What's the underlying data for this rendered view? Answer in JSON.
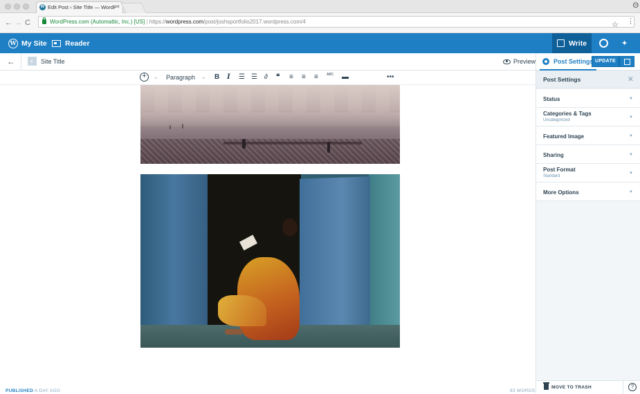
{
  "browser": {
    "tab_title": "Edit Post ‹ Site Title — WordP",
    "tab_close": "×",
    "nav_back": "←",
    "nav_forward": "→",
    "nav_reload": "C",
    "secure_label": "WordPress.com (Automattic, Inc.) [US]",
    "url_separator": "|",
    "url_scheme": "https://",
    "url_host": "wordpress.com",
    "url_path": "/post/joshsportfolio2017.wordpress.com/4",
    "star": "☆",
    "menu": "⋮",
    "profile": "Θ"
  },
  "masterbar": {
    "my_site": "My Site",
    "reader": "Reader",
    "write": "Write",
    "accent": "#1f7fc4"
  },
  "editor": {
    "back": "←",
    "site_title": "Site Title",
    "preview": "Preview",
    "post_settings_tab": "Post Settings",
    "update": "UPDATE"
  },
  "toolbar": {
    "add": "+",
    "add_caret": "⌄",
    "format": "Paragraph",
    "format_caret": "⌄",
    "bold": "B",
    "italic": "I",
    "bullet_list": "☰",
    "numbered_list": "☰",
    "link": "∂",
    "quote": "❝",
    "align_left": "≡",
    "align_center": "≡",
    "align_right": "≡",
    "spellcheck": "ABC",
    "read_more": "▬",
    "more": "•••"
  },
  "status": {
    "published_strong": "PUBLISHED",
    "published_rest": "A DAY AGO",
    "word_count": "83 WORDS"
  },
  "sidebar": {
    "title": "Post Settings",
    "close": "✕",
    "items": [
      {
        "label": "Status",
        "sub": ""
      },
      {
        "label": "Categories & Tags",
        "sub": "Uncategorized"
      },
      {
        "label": "Featured Image",
        "sub": ""
      },
      {
        "label": "Sharing",
        "sub": ""
      },
      {
        "label": "Post Format",
        "sub": "Standard"
      },
      {
        "label": "More Options",
        "sub": ""
      }
    ],
    "caret": "▼",
    "trash": "MOVE TO TRASH",
    "help": "?"
  }
}
